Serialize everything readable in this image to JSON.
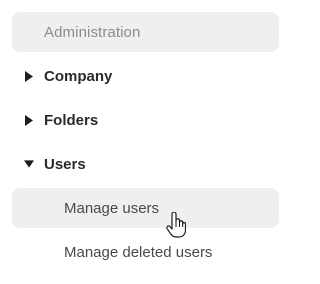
{
  "nav": {
    "section_title": "Administration",
    "groups": [
      {
        "label": "Company",
        "expanded": false,
        "icon": "caret-right-icon"
      },
      {
        "label": "Folders",
        "expanded": false,
        "icon": "caret-right-icon"
      },
      {
        "label": "Users",
        "expanded": true,
        "icon": "caret-down-icon"
      }
    ],
    "users_items": [
      {
        "label": "Manage users",
        "active": true
      },
      {
        "label": "Manage deleted users",
        "active": false
      }
    ]
  },
  "colors": {
    "highlight_bg": "#efefef",
    "header_text": "#8c8c8c",
    "group_text": "#2b2b2b",
    "item_text": "#4a4a4a"
  },
  "cursor": {
    "icon": "hand-pointer-icon"
  }
}
